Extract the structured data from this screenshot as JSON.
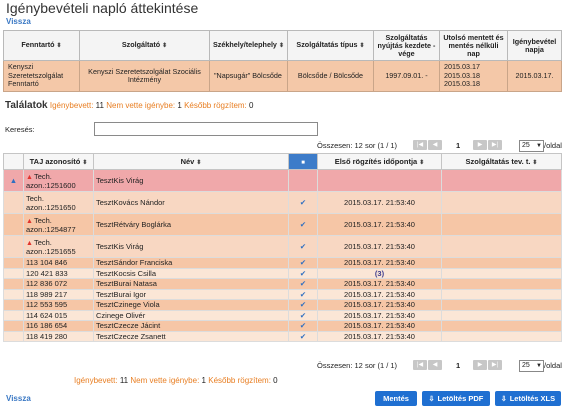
{
  "page": {
    "title": "Igénybevételi napló áttekintése",
    "back_label": "Vissza"
  },
  "summary": {
    "headers": [
      "Fenntartó",
      "Szolgáltató",
      "Székhely/telephely",
      "Szolgáltatás típus",
      "Szolgáltatás nyújtás kezdete - vége",
      "Utolsó mentett és mentés nélküli nap",
      "Igénybevétel napja"
    ],
    "row": {
      "fenntarto": "Kenyszi Szeretetszolgálat Fenntartó",
      "szolgaltato": "Kenyszi Szeretetszolgálat Szociális Intézmény",
      "szekhely": "\"Napsugár\" Bölcsőde",
      "tipus": "Bölcsőde / Bölcsőde",
      "kezdete": "1997.09.01. -",
      "utolso": [
        "2015.03.17",
        "2015.03.18",
        "2015.03.18"
      ],
      "napja": "2015.03.17."
    }
  },
  "results": {
    "label": "Találatok",
    "igenybevett_label": "Igénybevett:",
    "igenybevett_count": "11",
    "nem_vette_label": "Nem vette igénybe:",
    "nem_vette_count": "1",
    "kesobb_label": "Később rögzítem:",
    "kesobb_count": "0"
  },
  "search": {
    "label": "Keresés:",
    "value": ""
  },
  "pager": {
    "total_text": "Összesen: 12 sor (1 / 1)",
    "page": "1",
    "per_page": "25",
    "per_page_suffix": "/oldal"
  },
  "table": {
    "headers": {
      "taj": "TAJ azonosító",
      "nev": "Név",
      "first": "Első rögzítés időpontja",
      "tev": "Szolgáltatás tev. t."
    },
    "tall_rows": [
      {
        "taj_l1": "Tech.",
        "taj_l2": "azon.:1251600",
        "name": "TesztKis Virág",
        "time": ""
      },
      {
        "taj_l1": "Tech.",
        "taj_l2": "azon.:1251650",
        "name": "TesztKovács Nándor",
        "time": "2015.03.17. 21:53:40"
      },
      {
        "taj_l1": "Tech.",
        "taj_l2": "azon.:1254877",
        "name": "TesztRétváry Boglárka",
        "time": "2015.03.17. 21:53:40"
      },
      {
        "taj_l1": "Tech.",
        "taj_l2": "azon.:1251655",
        "name": "TesztKis Virág",
        "time": "2015.03.17. 21:53:40"
      }
    ],
    "rows": [
      {
        "taj": "113 104 846",
        "name": "TesztSándor Franciska",
        "time": "2015.03.17. 21:53:40"
      },
      {
        "taj": "120 421 833",
        "name": "TesztKocsis Csilla",
        "time": "(3)"
      },
      {
        "taj": "112 836 072",
        "name": "TesztBurai Natasa",
        "time": "2015.03.17. 21:53:40"
      },
      {
        "taj": "118 989 217",
        "name": "TesztBurai Igor",
        "time": "2015.03.17. 21:53:40"
      },
      {
        "taj": "112 553 595",
        "name": "TesztCzinege Viola",
        "time": "2015.03.17. 21:53:40"
      },
      {
        "taj": "114 624 015",
        "name": "Czinege Olivér",
        "time": "2015.03.17. 21:53:40"
      },
      {
        "taj": "116 186 654",
        "name": "TesztCzecze Jácint",
        "time": "2015.03.17. 21:53:40"
      },
      {
        "taj": "118 419 280",
        "name": "TesztCzecze Zsanett",
        "time": "2015.03.17. 21:53:40"
      }
    ]
  },
  "buttons": {
    "save": "Mentés",
    "pdf": "Letöltés PDF",
    "xls": "Letöltés XLS"
  },
  "colors": {
    "accent": "#1f6fd1",
    "link": "#3a78c4",
    "orange": "#e87e22",
    "summary_row": "#f4c8a8",
    "first_row": "#f0a8aa"
  }
}
